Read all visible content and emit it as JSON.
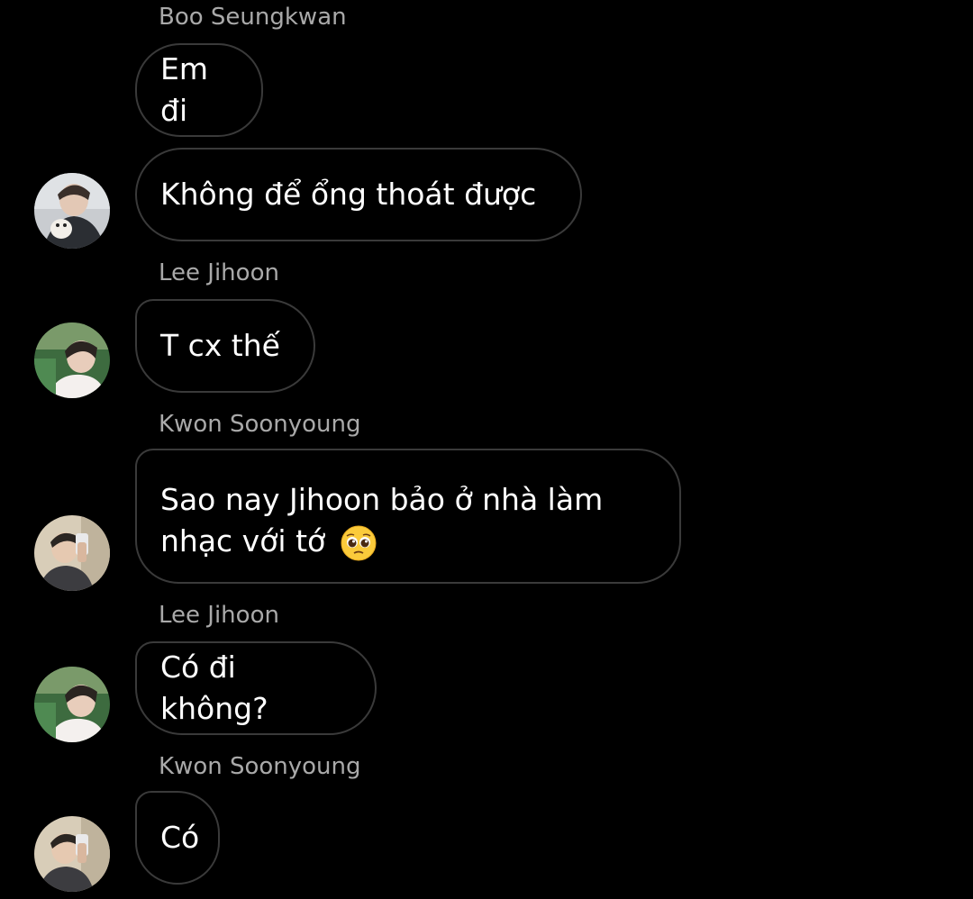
{
  "messages": [
    {
      "sender": "Boo Seungkwan",
      "text": "Em đi"
    },
    {
      "text": "Không để ổng thoát được"
    },
    {
      "sender": "Lee Jihoon",
      "text": "T cx thế"
    },
    {
      "sender": "Kwon Soonyoung",
      "text_line1": "Sao nay Jihoon bảo ở nhà làm",
      "text_line2": "nhạc với tớ",
      "emoji": "pleading-face"
    },
    {
      "sender": "Lee Jihoon",
      "text": "Có đi không?"
    },
    {
      "sender": "Kwon Soonyoung",
      "text": "Có"
    }
  ],
  "colors": {
    "background": "#000000",
    "bubble_border": "#3a3a3a",
    "sender_name": "#a9a9a9",
    "message_text": "#ffffff"
  }
}
